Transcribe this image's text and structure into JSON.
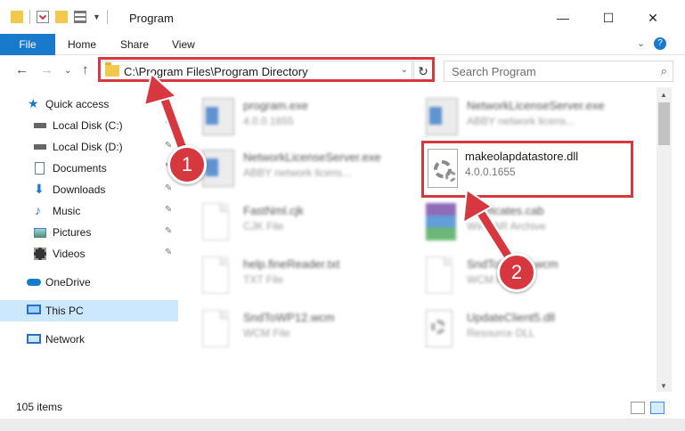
{
  "window": {
    "title": "Program",
    "minimize_glyph": "—",
    "maximize_glyph": "☐",
    "close_glyph": "✕"
  },
  "ribbon": {
    "file_tab": "File",
    "tabs": [
      "Home",
      "Share",
      "View"
    ],
    "expand_glyph": "⌄",
    "help_glyph": "?"
  },
  "nav": {
    "back": "←",
    "forward": "→",
    "recent": "⌄",
    "up": "↑"
  },
  "address": {
    "path": "C:\\Program Files\\Program Directory",
    "dropdown": "⌄",
    "refresh": "↻"
  },
  "search": {
    "placeholder": "Search Program",
    "icon": "⌕"
  },
  "sidebar": {
    "items": [
      {
        "label": "Quick access",
        "icon": "star-icon",
        "pinned": false
      },
      {
        "label": "Local Disk (C:)",
        "icon": "drive-icon",
        "pinned": true
      },
      {
        "label": "Local Disk (D:)",
        "icon": "drive-icon",
        "pinned": true
      },
      {
        "label": "Documents",
        "icon": "documents-icon",
        "pinned": true
      },
      {
        "label": "Downloads",
        "icon": "downloads-icon",
        "pinned": true
      },
      {
        "label": "Music",
        "icon": "music-icon",
        "pinned": true
      },
      {
        "label": "Pictures",
        "icon": "pictures-icon",
        "pinned": true
      },
      {
        "label": "Videos",
        "icon": "videos-icon",
        "pinned": true
      },
      {
        "label": "OneDrive",
        "icon": "onedrive-icon",
        "pinned": false
      },
      {
        "label": "This PC",
        "icon": "this-pc-icon",
        "pinned": false
      },
      {
        "label": "Network",
        "icon": "network-icon",
        "pinned": false
      }
    ],
    "pin_glyph": "📌"
  },
  "files": [
    {
      "name": "program.exe",
      "type": "4.0.0.1655",
      "icon": "exe-icon"
    },
    {
      "name": "NetworkLicenseServer.exe",
      "type": "ABBY network licens...",
      "icon": "window-icon"
    },
    {
      "name": "NetworkLicenseServer.exe",
      "type": "ABBY network licens...",
      "icon": "window-icon"
    },
    {
      "name": "makeolapdatastore.dll",
      "type": "4.0.0.1655",
      "icon": "dll-gear-icon"
    },
    {
      "name": "FastNml.cjk",
      "type": "CJK File",
      "icon": "blank-file-icon"
    },
    {
      "name": "certificates.cab",
      "type": "WinRAR Archive",
      "icon": "winrar-icon"
    },
    {
      "name": "help.fineReader.txt",
      "type": "TXT File",
      "icon": "blank-file-icon"
    },
    {
      "name": "SndToWP12.wcm",
      "type": "WCM File",
      "icon": "blank-file-icon"
    },
    {
      "name": "SndToWP12.wcm",
      "type": "WCM File",
      "icon": "blank-file-icon"
    },
    {
      "name": "UpdateClient5.dll",
      "type": "Resource DLL",
      "icon": "dll-gear-icon"
    }
  ],
  "status": {
    "item_count": "105 items"
  },
  "annotations": {
    "step1": "1",
    "step2": "2",
    "color": "#d7373f"
  },
  "colors": {
    "accent": "#1979ca",
    "selection": "#cce8ff",
    "highlight": "#d7373f"
  }
}
